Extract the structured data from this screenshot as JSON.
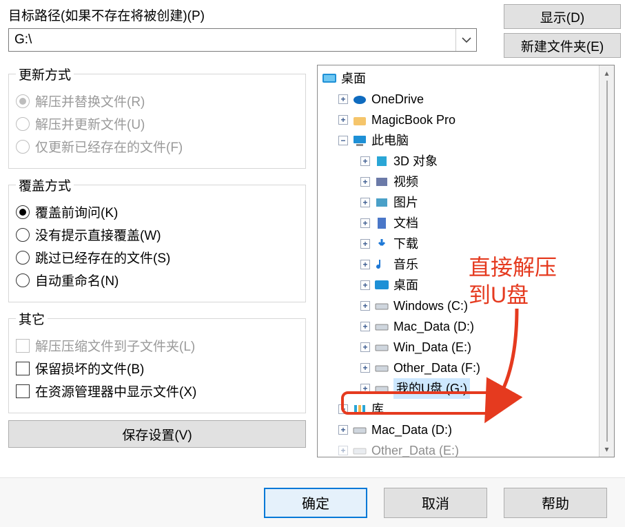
{
  "path": {
    "label": "目标路径(如果不存在将被创建)(P)",
    "value": "G:\\"
  },
  "buttons": {
    "show": "显示(D)",
    "newFolder": "新建文件夹(E)",
    "saveSettings": "保存设置(V)",
    "ok": "确定",
    "cancel": "取消",
    "help": "帮助"
  },
  "groups": {
    "updateMode": {
      "legend": "更新方式",
      "o1": "解压并替换文件(R)",
      "o2": "解压并更新文件(U)",
      "o3": "仅更新已经存在的文件(F)"
    },
    "overwriteMode": {
      "legend": "覆盖方式",
      "o1": "覆盖前询问(K)",
      "o2": "没有提示直接覆盖(W)",
      "o3": "跳过已经存在的文件(S)",
      "o4": "自动重命名(N)"
    },
    "misc": {
      "legend": "其它",
      "o1": "解压压缩文件到子文件夹(L)",
      "o2": "保留损坏的文件(B)",
      "o3": "在资源管理器中显示文件(X)"
    }
  },
  "tree": {
    "desktop": "桌面",
    "onedrive": "OneDrive",
    "magicbook": "MagicBook Pro",
    "thispc": "此电脑",
    "objects3d": "3D 对象",
    "videos": "视频",
    "pictures": "图片",
    "documents": "文档",
    "downloads": "下载",
    "music": "音乐",
    "deskfolder": "桌面",
    "winc": "Windows (C:)",
    "macd": "Mac_Data (D:)",
    "wine": "Win_Data (E:)",
    "otherf": "Other_Data (F:)",
    "usbg": "我的U盘 (G:)",
    "libraries": "库",
    "macd2": "Mac_Data (D:)",
    "othere2": "Other_Data (E:)"
  },
  "annotation": {
    "line1": "直接解压",
    "line2": "到U盘"
  }
}
